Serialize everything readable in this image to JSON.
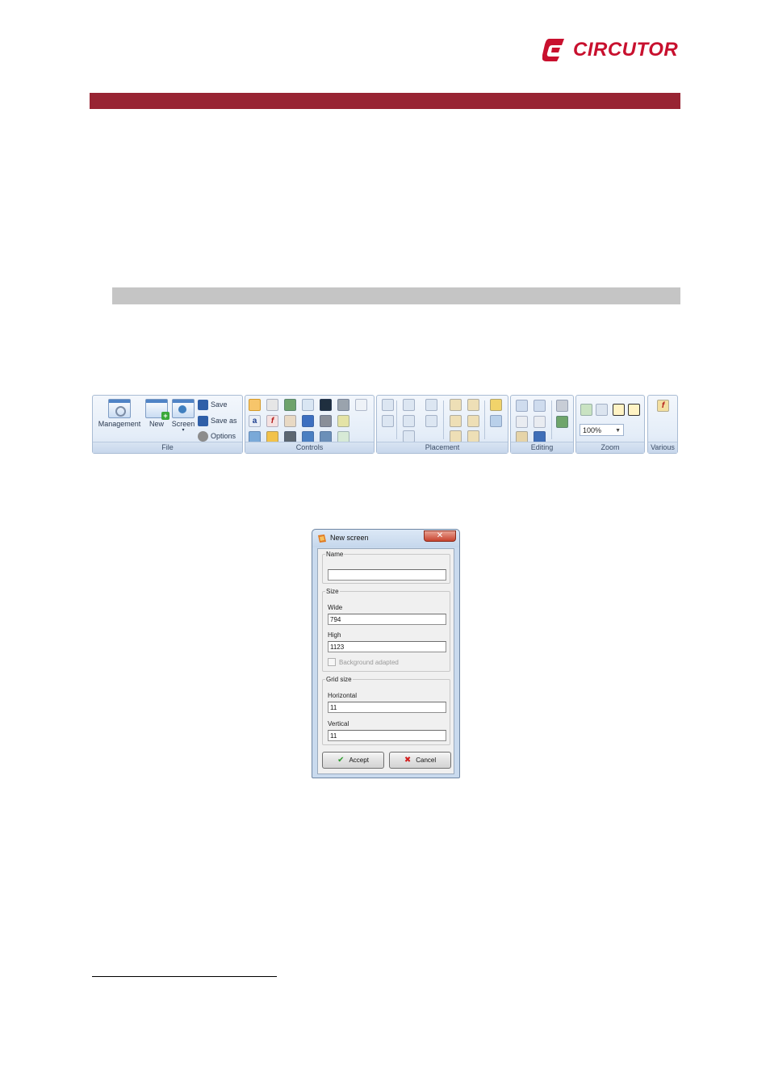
{
  "brand": {
    "name": "CIRCUTOR",
    "color": "#c8102e"
  },
  "header": {
    "accent_color": "#982433",
    "subbar_color": "#c5c5c5"
  },
  "ribbon": {
    "groups": {
      "file": "File",
      "controls": "Controls",
      "placement": "Placement",
      "editing": "Editing",
      "zoom": "Zoom",
      "various": "Various"
    },
    "file_buttons": {
      "management": "Management",
      "new": "New",
      "screen": "Screen",
      "save": "Save",
      "save_as": "Save as",
      "options": "Options"
    },
    "zoom_value": "100%"
  },
  "dialog": {
    "title": "New screen",
    "close_glyph": "✕",
    "name_group": {
      "legend": "Name",
      "value": ""
    },
    "size_group": {
      "legend": "Size",
      "wide_label": "Wide",
      "wide_value": "794",
      "high_label": "High",
      "high_value": "1123",
      "checkbox_label": "Background adapted"
    },
    "grid_group": {
      "legend": "Grid size",
      "horizontal_label": "Horizontal",
      "horizontal_value": "11",
      "vertical_label": "Vertical",
      "vertical_value": "11"
    },
    "accept_label": "Accept",
    "cancel_label": "Cancel"
  }
}
